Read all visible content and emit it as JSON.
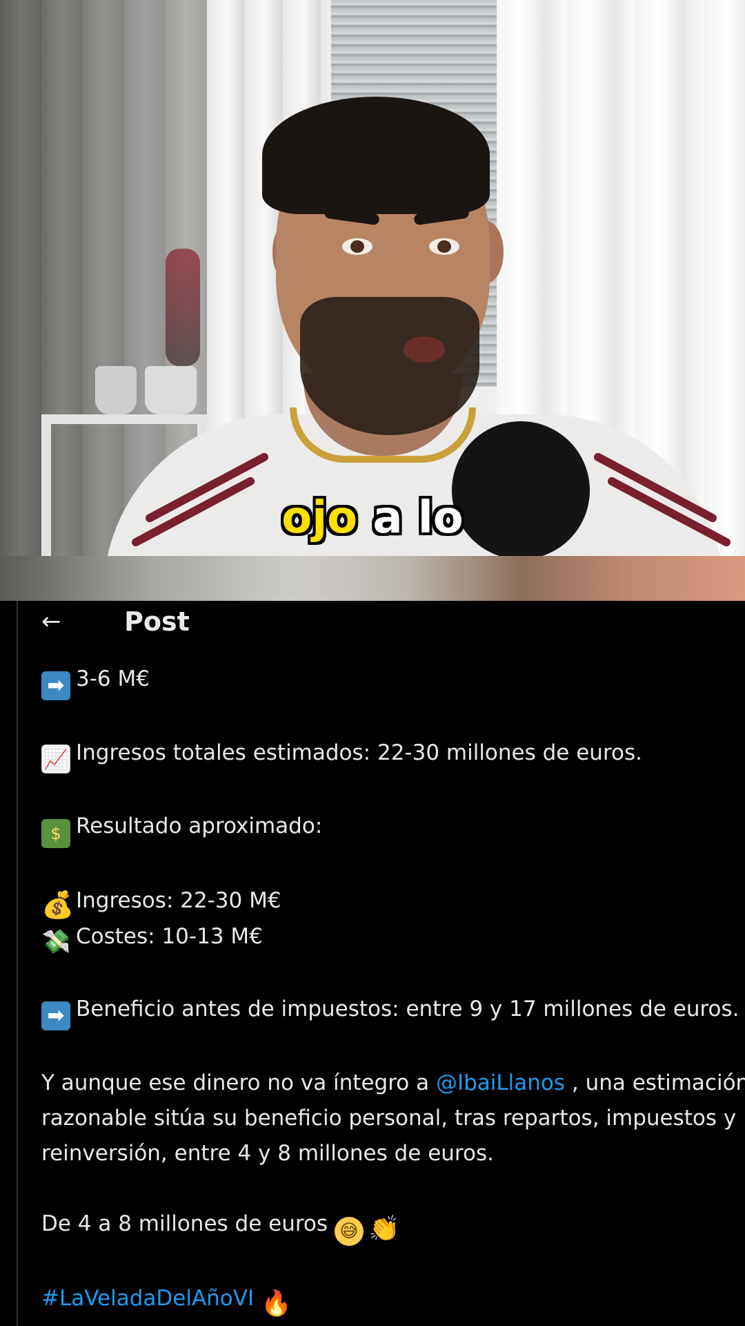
{
  "video": {
    "caption_highlight": "ojo",
    "caption_rest": "a lo"
  },
  "post": {
    "back_icon": "←",
    "title": "Post",
    "lines": {
      "l1_text": "3-6 M€",
      "l2_text": "Ingresos totales estimados: 22-30 millones de euros.",
      "l3_text": "Resultado aproximado:",
      "l4_text": "Ingresos: 22-30 M€",
      "l5_text": "Costes: 10-13 M€",
      "l6_text": "Beneficio antes de impuestos: entre 9 y 17 millones de euros.",
      "l7_before": "Y aunque ese dinero no va íntegro a ",
      "l7_mention": "@IbaiLlanos",
      "l7_after": " , una estimación",
      "l8_text": "razonable sitúa su beneficio personal, tras repartos, impuestos y",
      "l9_text": "reinversión, entre 4 y 8 millones de euros.",
      "l10_text": "De 4 a 8 millones de euros",
      "l11_hashtag": "#LaVeladaDelAñoVI"
    },
    "emoji": {
      "arrow": "➡",
      "chart": "📈",
      "money": "$",
      "moneybag": "💰",
      "flying_money": "💸",
      "sweat_smile": "😅",
      "clap": "👏",
      "fire": "🔥"
    }
  }
}
